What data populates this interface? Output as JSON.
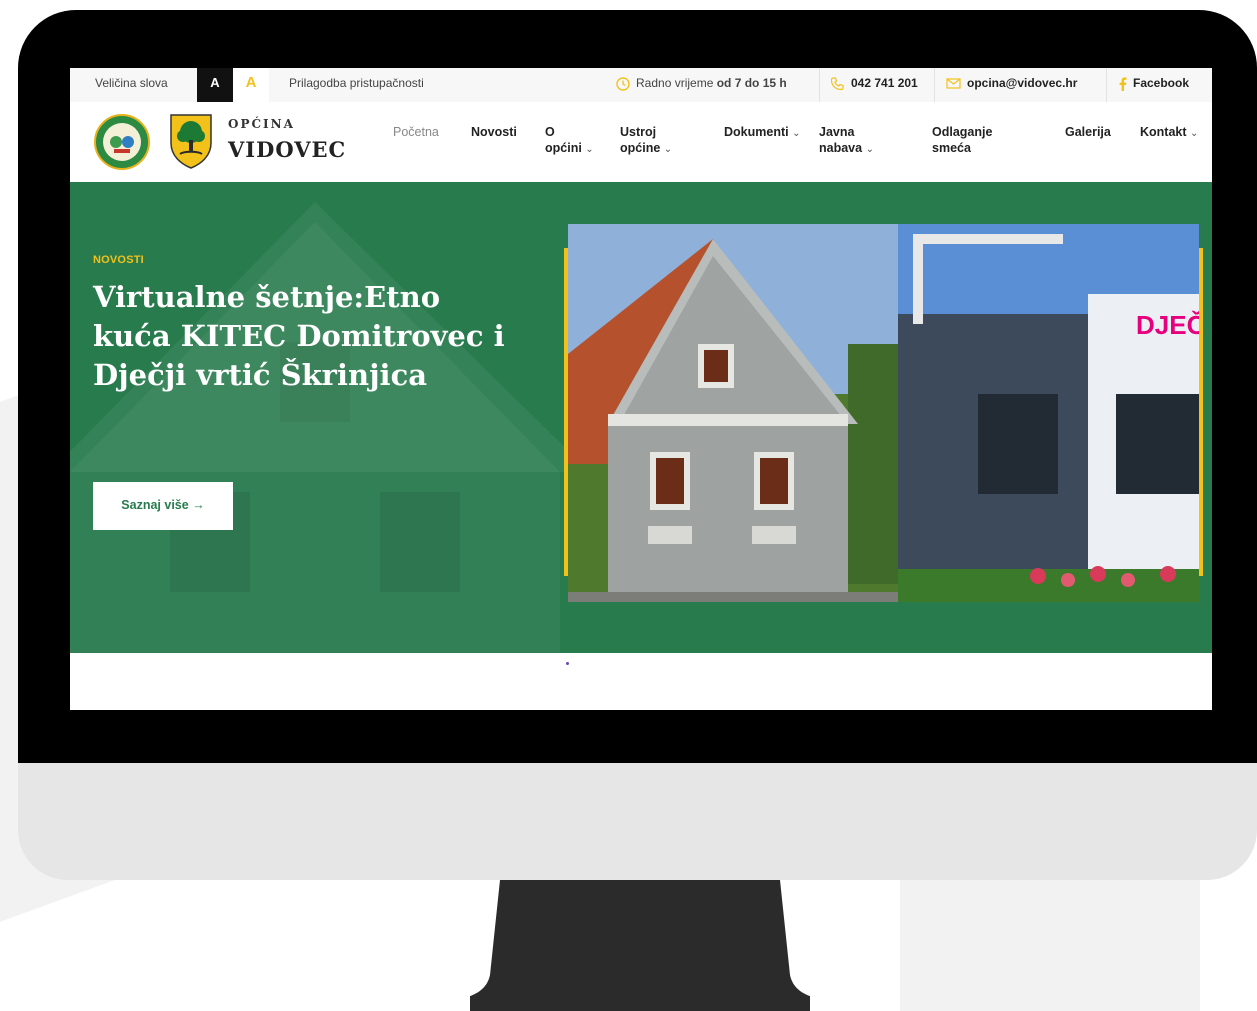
{
  "topbar": {
    "font_size_label": "Veličina slova",
    "font_small": "A",
    "font_large": "A",
    "accessibility": "Prilagodba pristupačnosti",
    "hours_label": "Radno vrijeme",
    "hours_value": "od  7 do 15 h",
    "phone": "042 741 201",
    "email": "opcina@vidovec.hr",
    "facebook": "Facebook"
  },
  "brand": {
    "line1": "OPĆINA",
    "line2": "VIDOVEC"
  },
  "nav": [
    {
      "label": "Početna"
    },
    {
      "label": "Novosti"
    },
    {
      "label": "O",
      "label2": "općini"
    },
    {
      "label": "Ustroj",
      "label2": "općine"
    },
    {
      "label": "Dokumenti"
    },
    {
      "label": "Javna",
      "label2": "nabava"
    },
    {
      "label": "Odlaganje",
      "label2": "smeća"
    },
    {
      "label": "Galerija"
    },
    {
      "label": "Kontakt"
    }
  ],
  "hero": {
    "tag": "NOVOSTI",
    "title": "Virtualne šetnje:Etno kuća KITEC Domitrovec i Dječji vrtić Škrinjica",
    "cta": "Saznaj više",
    "cta_arrow": "→",
    "sign_text": "DJEČ ŠKR"
  },
  "colors": {
    "green": "#287b4d",
    "gold": "#f2c21b",
    "bezel": "#000000",
    "stand": "#2b2b2b"
  }
}
